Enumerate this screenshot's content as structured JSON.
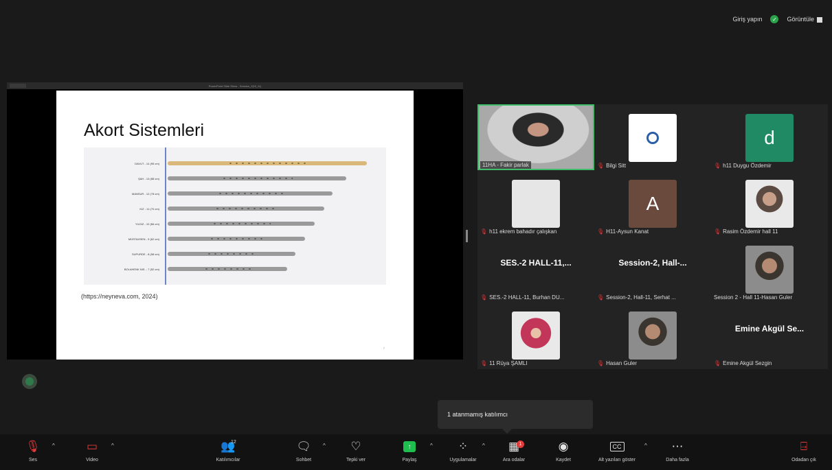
{
  "topbar": {
    "login_label": "Giriş yapın",
    "view_label": "Görüntüle"
  },
  "share": {
    "window_title": "PowerPoint Slide Show - Session_2(Hl_11)",
    "slide_title": "Akort Sistemleri",
    "rows": [
      {
        "label": "DAVUT - 14 (95 cm)",
        "color": "#d9b87a"
      },
      {
        "label": "ŞAH - 13 (88 cm)",
        "color": "#9a9a9a"
      },
      {
        "label": "MANSUR - 12 (78 cm)",
        "color": "#9a9a9a"
      },
      {
        "label": "KIZ - 11 (70 cm)",
        "color": "#9a9a9a"
      },
      {
        "label": "YILDIZ - 10 (66 cm)",
        "color": "#9a9a9a"
      },
      {
        "label": "MÜSTAHSEN - 9 (62 cm)",
        "color": "#9a9a9a"
      },
      {
        "label": "SUPURDE - 8 (58 cm)",
        "color": "#9a9a9a"
      },
      {
        "label": "BOLAHENK NIS. - 7 (52 cm)",
        "color": "#9a9a9a"
      }
    ],
    "citation": "(https://neyneva.com, 2024)",
    "page_number": "7"
  },
  "gallery": {
    "tiles": [
      {
        "name": "11HA - Fakir parlak",
        "kind": "main",
        "muted": false
      },
      {
        "name": "Bilgi Sitt",
        "kind": "logo",
        "muted": true
      },
      {
        "name": "h11 Duygu Özdemir",
        "kind": "letter",
        "letter": "d",
        "bg": "#1f8a64",
        "muted": true
      },
      {
        "name": "h11 ekrem bahadır çalışkan",
        "kind": "blank",
        "muted": true
      },
      {
        "name": "H11-Aysun Kanat",
        "kind": "letter",
        "letter": "A",
        "bg": "#6b4a3e",
        "muted": true
      },
      {
        "name": "Rasim Özdemir hall 11",
        "kind": "face",
        "muted": true
      },
      {
        "name": "SES.-2 HALL-11, Burhan DU...",
        "kind": "text",
        "big": "SES.-2  HALL-11,...",
        "muted": true
      },
      {
        "name": "Session-2, Hall-11, Serhat ...",
        "kind": "text",
        "big": "Session-2,  Hall-...",
        "muted": true
      },
      {
        "name": "Session 2 - Hall 11-Hasan Guler",
        "kind": "face-dark",
        "muted": false
      },
      {
        "name": "11 Rüya ŞAMLI",
        "kind": "hijab",
        "muted": true
      },
      {
        "name": "Hasan Guler",
        "kind": "face-dark",
        "muted": true
      },
      {
        "name": "Emine Akgül Sezgin",
        "kind": "text",
        "big": "Emine  Akgül  Se...",
        "muted": true
      }
    ]
  },
  "toast": {
    "text": "1 atanmamış katılımcı"
  },
  "toolbar": {
    "audio": "Ses",
    "video": "Video",
    "participants": "Katılımcılar",
    "participants_count": "12",
    "chat": "Sohbet",
    "react": "Tepki ver",
    "share": "Paylaş",
    "apps": "Uygulamalar",
    "breakout": "Ara odalar",
    "breakout_count": "1",
    "record": "Kaydet",
    "captions": "Alt yazıları göster",
    "more": "Daha fazla",
    "leave": "Odadan çık"
  }
}
